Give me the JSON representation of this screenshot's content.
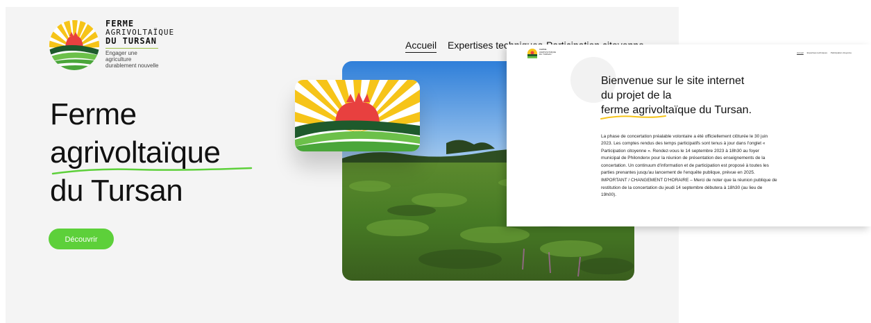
{
  "logo": {
    "line1": "FERME",
    "line2": "AGRIVOLTAÏQUE",
    "line3": "DU TURSAN",
    "tagline": "Engager une agriculture durablement nouvelle"
  },
  "nav": {
    "items": [
      "Accueil",
      "Expertises techniques",
      "Participation citoyenne"
    ],
    "active": "Accueil"
  },
  "hero": {
    "title_line1": "Ferme",
    "title_line2": "agrivoltaïque",
    "title_line3": "du Tursan",
    "cta_label": "Découvrir"
  },
  "overlay": {
    "nav_items": [
      "Accueil",
      "Expertises techniques",
      "Participation citoyenne"
    ],
    "title_line1": "Bienvenue sur le site internet",
    "title_line2": "du projet de la",
    "title_line3": "ferme agrivoltaïque du Tursan.",
    "paragraph1": "La phase de concertation préalable volontaire a été officiellement clôturée le 30 juin 2023. Les comptes rendus des temps participatifs sont tenus à jour dans l'onglet « Participation citoyenne ». Rendez-vous le 14 septembre 2023 à 18h30 au foyer municipal de Philondenx pour la réunion de présentation des enseignements de la concertation. Un continuum d'information et de participation est proposé à toutes les parties prenantes jusqu'au lancement de l'enquête publique, prévue en 2025.",
    "paragraph2": "IMPORTANT / CHANGEMENT D'HORAIRE – Merci de noter que la réunion publique de restitution de la concertation du jeudi 14 septembre débutera à 18h30 (au lieu de 19h00)."
  },
  "colors": {
    "accent_green": "#5dd03a",
    "logo_yellow": "#f6c419",
    "logo_red": "#e8403f",
    "logo_dark_green": "#1e5a2c"
  }
}
